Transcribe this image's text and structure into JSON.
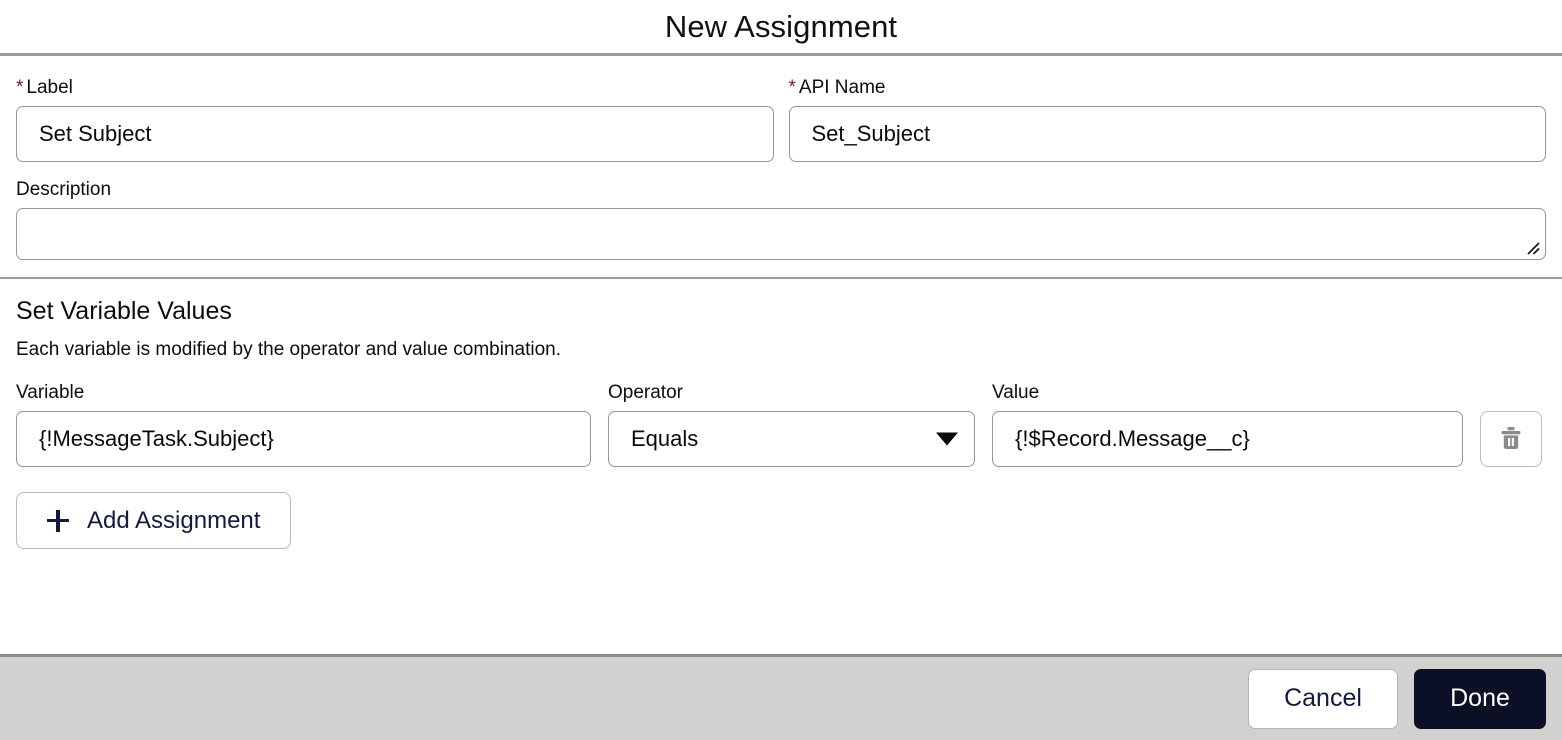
{
  "dialog": {
    "title": "New Assignment"
  },
  "form": {
    "label_field": {
      "label": "Label",
      "required_marker": "*",
      "value": "Set Subject",
      "placeholder": ""
    },
    "api_name_field": {
      "label": "API Name",
      "required_marker": "*",
      "value": "Set_Subject",
      "placeholder": ""
    },
    "description_field": {
      "label": "Description",
      "value": "",
      "placeholder": ""
    }
  },
  "set_variable_values": {
    "heading": "Set Variable Values",
    "subtitle": "Each variable is modified by the operator and value combination.",
    "columns": {
      "variable": "Variable",
      "operator": "Operator",
      "value": "Value"
    },
    "rows": [
      {
        "variable": "{!MessageTask.Subject}",
        "operator": "Equals",
        "value": "{!$Record.Message__c}",
        "delete_icon": "trash-icon"
      }
    ],
    "add_assignment_label": "Add Assignment",
    "add_icon": "plus-icon"
  },
  "footer": {
    "cancel_label": "Cancel",
    "done_label": "Done"
  },
  "colors": {
    "required_marker": "#7d1c17",
    "primary_button_bg": "#0b1026",
    "footer_bg": "#d3d1cf",
    "input_border": "#969696",
    "link_text": "#131a3e"
  }
}
